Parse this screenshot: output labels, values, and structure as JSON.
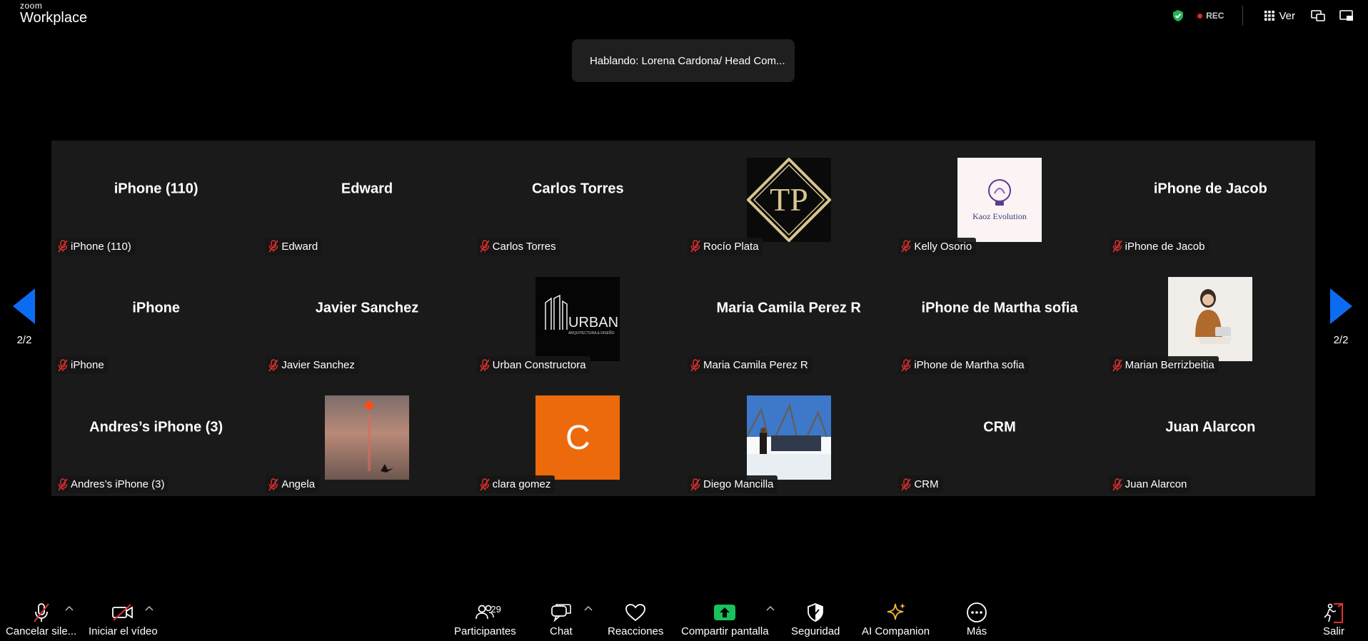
{
  "app": {
    "brand_top": "zoom",
    "brand_bottom": "Workplace"
  },
  "topbar": {
    "rec_label": "REC",
    "view_label": "Ver"
  },
  "speaking": {
    "text": "Hablando: Lorena Cardona/ Head Com..."
  },
  "pager": {
    "left_label": "2/2",
    "right_label": "2/2"
  },
  "tiles": [
    {
      "name": "iPhone (110)",
      "display": "iPhone (110)",
      "muted": true,
      "avatar": null
    },
    {
      "name": "Edward",
      "display": "Edward",
      "muted": true,
      "avatar": null
    },
    {
      "name": "Carlos Torres",
      "display": "Carlos Torres",
      "muted": true,
      "avatar": null
    },
    {
      "name": "Rocío Plata",
      "display": "",
      "muted": true,
      "avatar": "tp-logo",
      "avatar_text": "TP"
    },
    {
      "name": "Kelly Osorio",
      "display": "",
      "muted": true,
      "avatar": "kaoz-logo",
      "avatar_text": "Kaoz Evolution"
    },
    {
      "name": "iPhone de Jacob",
      "display": "iPhone de Jacob",
      "muted": true,
      "avatar": null
    },
    {
      "name": "iPhone",
      "display": "iPhone",
      "muted": true,
      "avatar": null
    },
    {
      "name": "Javier Sanchez",
      "display": "Javier Sanchez",
      "muted": true,
      "avatar": null
    },
    {
      "name": "Urban Constructora",
      "display": "",
      "muted": true,
      "avatar": "urban-logo",
      "avatar_text": "URBAN",
      "avatar_subtext": "ARQUITECTURA & DISEÑO"
    },
    {
      "name": "Maria Camila Perez R",
      "display": "Maria Camila Perez R",
      "muted": true,
      "avatar": null
    },
    {
      "name": "iPhone de Martha sofia",
      "display": "iPhone de Martha sofia",
      "muted": true,
      "avatar": null
    },
    {
      "name": "Marian Berrizbeitia",
      "display": "",
      "muted": true,
      "avatar": "person-photo"
    },
    {
      "name": "Andres’s iPhone (3)",
      "display": "Andres’s iPhone (3)",
      "muted": true,
      "avatar": null
    },
    {
      "name": "Angela",
      "display": "",
      "muted": true,
      "avatar": "sunset-photo"
    },
    {
      "name": "clara gomez",
      "display": "",
      "muted": true,
      "avatar": "letter-avatar",
      "avatar_text": "C",
      "avatar_color": "#ec6a0b"
    },
    {
      "name": "Diego Mancilla",
      "display": "",
      "muted": true,
      "avatar": "outdoor-photo"
    },
    {
      "name": "CRM",
      "display": "CRM",
      "muted": true,
      "avatar": null
    },
    {
      "name": "Juan Alarcon",
      "display": "Juan Alarcon",
      "muted": true,
      "avatar": null
    }
  ],
  "toolbar": {
    "mute_label": "Cancelar sile...",
    "video_label": "Iniciar el vídeo",
    "participants_label": "Participantes",
    "participants_count": "29",
    "chat_label": "Chat",
    "reactions_label": "Reacciones",
    "share_label": "Compartir pantalla",
    "security_label": "Seguridad",
    "ai_label": "AI Companion",
    "more_label": "Más",
    "leave_label": "Salir"
  },
  "colors": {
    "accent_blue": "#0b6cf2",
    "share_green": "#18c25a",
    "muted_red": "#e0312e",
    "ai_gold": "#f0b93b"
  }
}
